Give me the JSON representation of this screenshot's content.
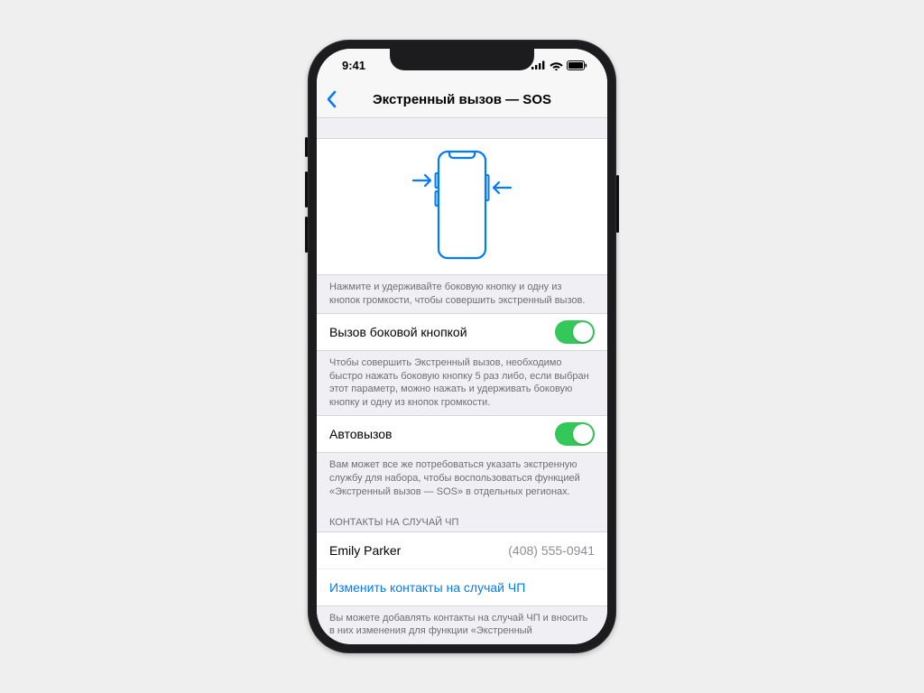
{
  "status": {
    "time": "9:41"
  },
  "nav": {
    "title": "Экстренный вызов — SOS"
  },
  "hero": {
    "footer": "Нажмите и удерживайте боковую кнопку и одну из кнопок громкости, чтобы совершить экстренный вызов."
  },
  "side_button": {
    "label": "Вызов боковой кнопкой",
    "enabled": true,
    "footer": "Чтобы совершить Экстренный вызов, необходимо быстро нажать боковую кнопку 5 раз либо, если выбран этот параметр, можно нажать и удерживать боковую кнопку и одну из кнопок громкости."
  },
  "auto_call": {
    "label": "Автовызов",
    "enabled": true,
    "footer": "Вам может все же потребоваться указать экстренную службу для набора, чтобы воспользоваться функцией «Экстренный вызов — SOS» в отдельных регионах."
  },
  "contacts": {
    "header": "КОНТАКТЫ НА СЛУЧАЙ ЧП",
    "items": [
      {
        "name": "Emily Parker",
        "phone": "(408) 555-0941"
      }
    ],
    "edit_label": "Изменить контакты на случай ЧП",
    "footer": "Вы можете добавлять контакты на случай ЧП и вносить в них изменения для функции «Экстренный"
  }
}
